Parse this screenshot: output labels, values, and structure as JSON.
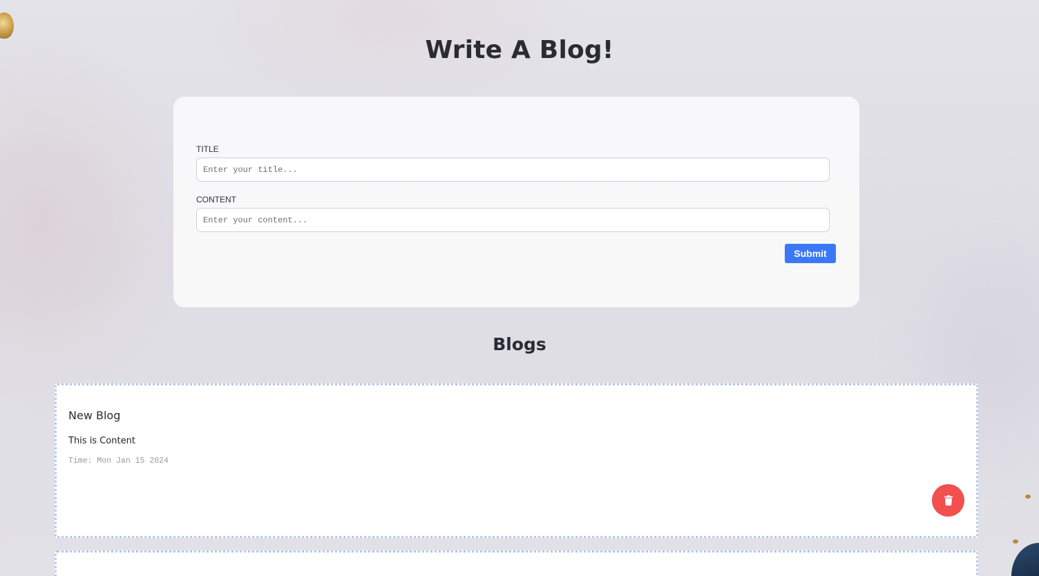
{
  "header": {
    "title": "Write A Blog!"
  },
  "form": {
    "title_label": "TITLE",
    "title_placeholder": "Enter your title...",
    "title_value": "",
    "content_label": "CONTENT",
    "content_placeholder": "Enter your content...",
    "content_value": "",
    "submit_label": "Submit"
  },
  "blogs": {
    "heading": "Blogs",
    "items": [
      {
        "title": "New Blog",
        "content": "This is Content",
        "time": "Time: Mon Jan 15 2024",
        "delete_icon": "trash-icon"
      }
    ]
  },
  "colors": {
    "accent": "#3b78f7",
    "danger": "#f24f4f",
    "card_border": "#b3c8ec"
  }
}
